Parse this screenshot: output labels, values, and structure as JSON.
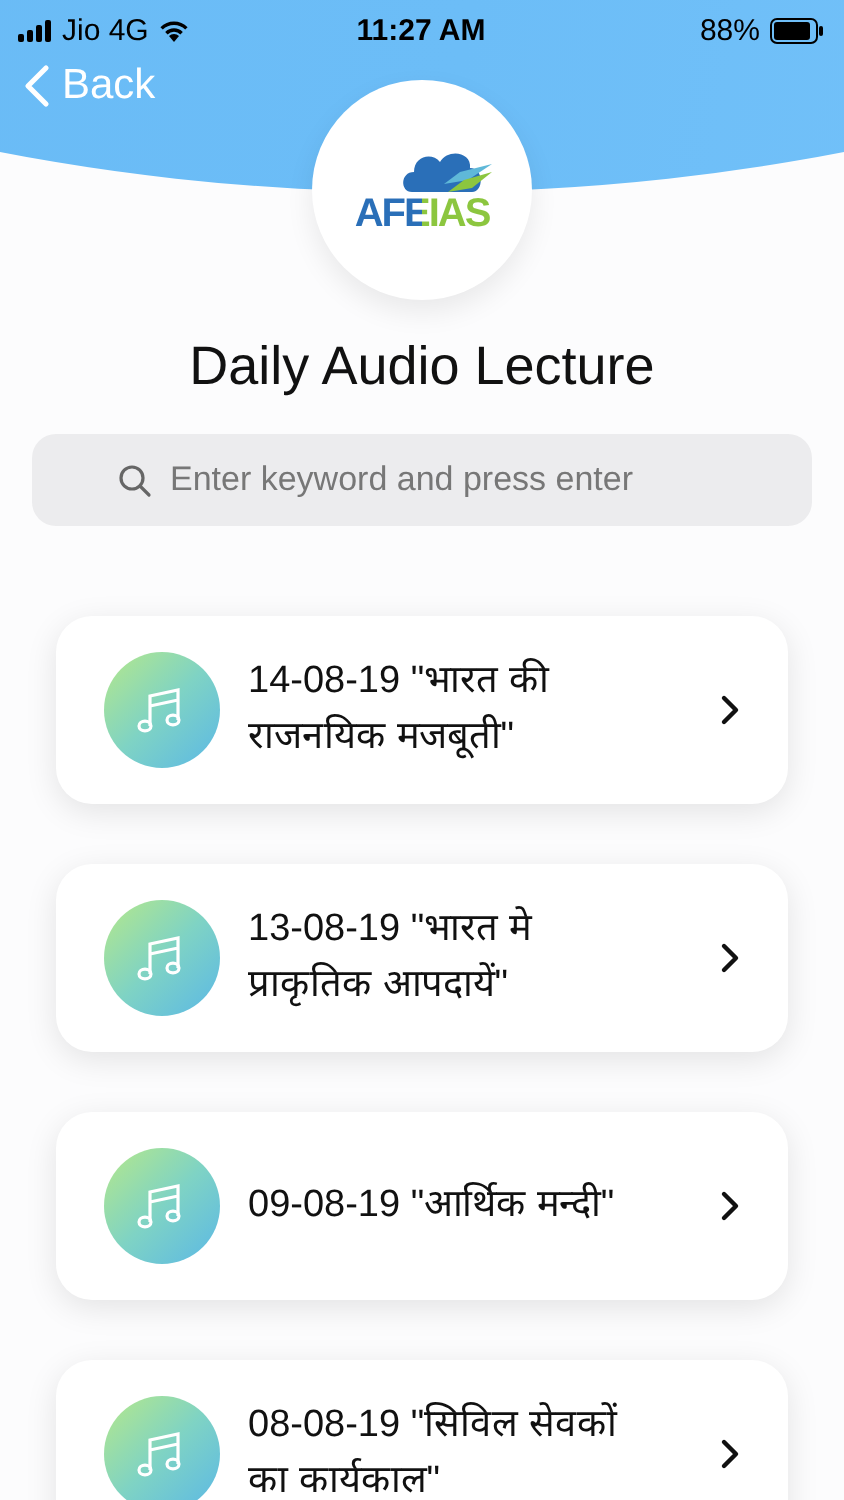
{
  "status_bar": {
    "carrier": "Jio 4G",
    "time": "11:27 AM",
    "battery": "88%"
  },
  "nav": {
    "back": "Back"
  },
  "logo": {
    "text": "AFEIAS"
  },
  "title": "Daily Audio Lecture",
  "search": {
    "placeholder": "Enter keyword and press enter"
  },
  "lectures": [
    {
      "title": "14-08-19 \"भारत की राजनयिक मजबूती\""
    },
    {
      "title": "13-08-19 \"भारत मे प्राकृतिक आपदायें\""
    },
    {
      "title": "09-08-19 \"आर्थिक मन्दी\""
    },
    {
      "title": "08-08-19 \"सिविल सेवकों का कार्यकाल\""
    }
  ]
}
